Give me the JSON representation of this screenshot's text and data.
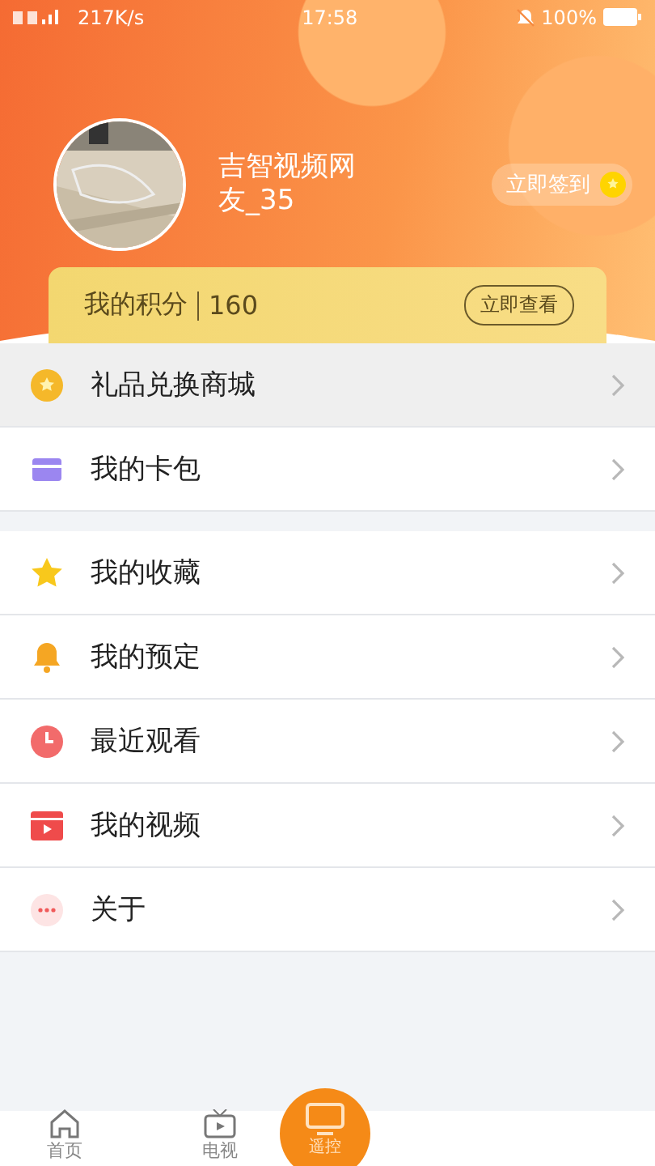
{
  "status_bar": {
    "speed": "217K/s",
    "time": "17:58",
    "battery": "100%"
  },
  "profile": {
    "name": "吉智视频网友_35",
    "checkin": "立即签到"
  },
  "points": {
    "label": "我的积分",
    "value": "160",
    "action": "立即查看"
  },
  "groups": [
    [
      {
        "kind": "coin",
        "label": "礼品兑换商城",
        "selected": true
      },
      {
        "kind": "card",
        "label": "我的卡包",
        "selected": false
      }
    ],
    [
      {
        "kind": "star",
        "label": "我的收藏",
        "selected": false
      },
      {
        "kind": "bell",
        "label": "我的预定",
        "selected": false
      },
      {
        "kind": "clock",
        "label": "最近观看",
        "selected": false
      },
      {
        "kind": "video",
        "label": "我的视频",
        "selected": false
      },
      {
        "kind": "more",
        "label": "关于",
        "selected": false
      }
    ]
  ],
  "nav": [
    {
      "kind": "home",
      "label": "首页"
    },
    {
      "kind": "tv",
      "label": "电视"
    },
    {
      "kind": "remote",
      "label": "遥控"
    }
  ]
}
